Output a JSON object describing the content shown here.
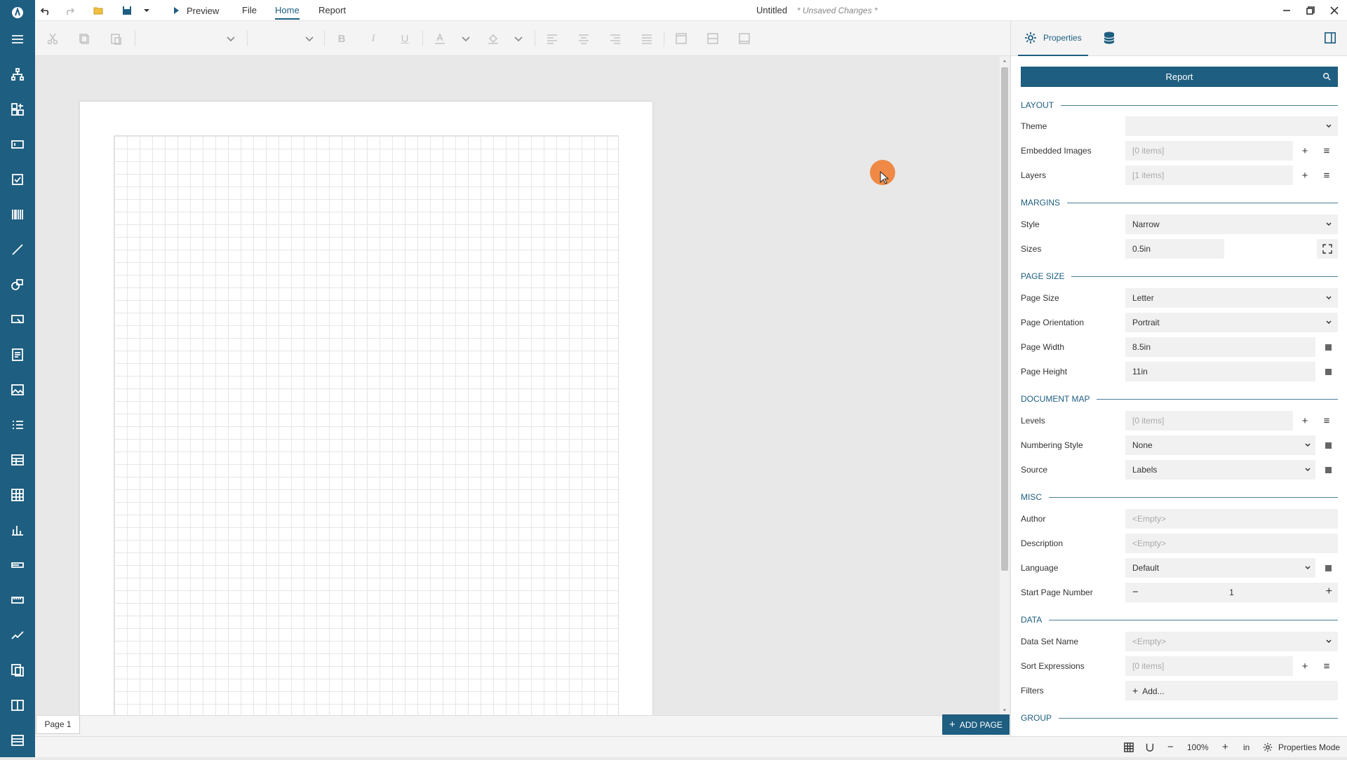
{
  "titlebar": {
    "preview_label": "Preview",
    "menus": [
      "File",
      "Home",
      "Report"
    ],
    "active_menu": "Home",
    "doc_title": "Untitled",
    "unsaved_label": "* Unsaved Changes *"
  },
  "canvas": {
    "page_tab": "Page 1",
    "add_page_label": "ADD PAGE"
  },
  "status": {
    "zoom": "100%",
    "unit": "in",
    "mode": "Properties Mode"
  },
  "panel": {
    "properties_tab": "Properties",
    "report_button": "Report",
    "sections": {
      "layout": "LAYOUT",
      "margins": "MARGINS",
      "page_size": "PAGE SIZE",
      "document_map": "DOCUMENT MAP",
      "misc": "MISC",
      "data": "DATA",
      "group": "GROUP"
    },
    "props": {
      "theme": {
        "label": "Theme",
        "value": ""
      },
      "embedded_images": {
        "label": "Embedded Images",
        "value": "[0 items]"
      },
      "layers": {
        "label": "Layers",
        "value": "[1 items]"
      },
      "style": {
        "label": "Style",
        "value": "Narrow"
      },
      "sizes": {
        "label": "Sizes",
        "value": "0.5in"
      },
      "page_size": {
        "label": "Page Size",
        "value": "Letter"
      },
      "page_orientation": {
        "label": "Page Orientation",
        "value": "Portrait"
      },
      "page_width": {
        "label": "Page Width",
        "value": "8.5in"
      },
      "page_height": {
        "label": "Page Height",
        "value": "11in"
      },
      "levels": {
        "label": "Levels",
        "value": "[0 items]"
      },
      "numbering_style": {
        "label": "Numbering Style",
        "value": "None"
      },
      "source": {
        "label": "Source",
        "value": "Labels"
      },
      "author": {
        "label": "Author",
        "placeholder": "<Empty>"
      },
      "description": {
        "label": "Description",
        "placeholder": "<Empty>"
      },
      "language": {
        "label": "Language",
        "value": "Default"
      },
      "start_page_number": {
        "label": "Start Page Number",
        "value": "1"
      },
      "data_set_name": {
        "label": "Data Set Name",
        "placeholder": "<Empty>"
      },
      "sort_expressions": {
        "label": "Sort Expressions",
        "value": "[0 items]"
      },
      "filters": {
        "label": "Filters",
        "value": "Add..."
      }
    }
  },
  "colors": {
    "accent": "#1e5e80",
    "cursor": "#f07828"
  }
}
